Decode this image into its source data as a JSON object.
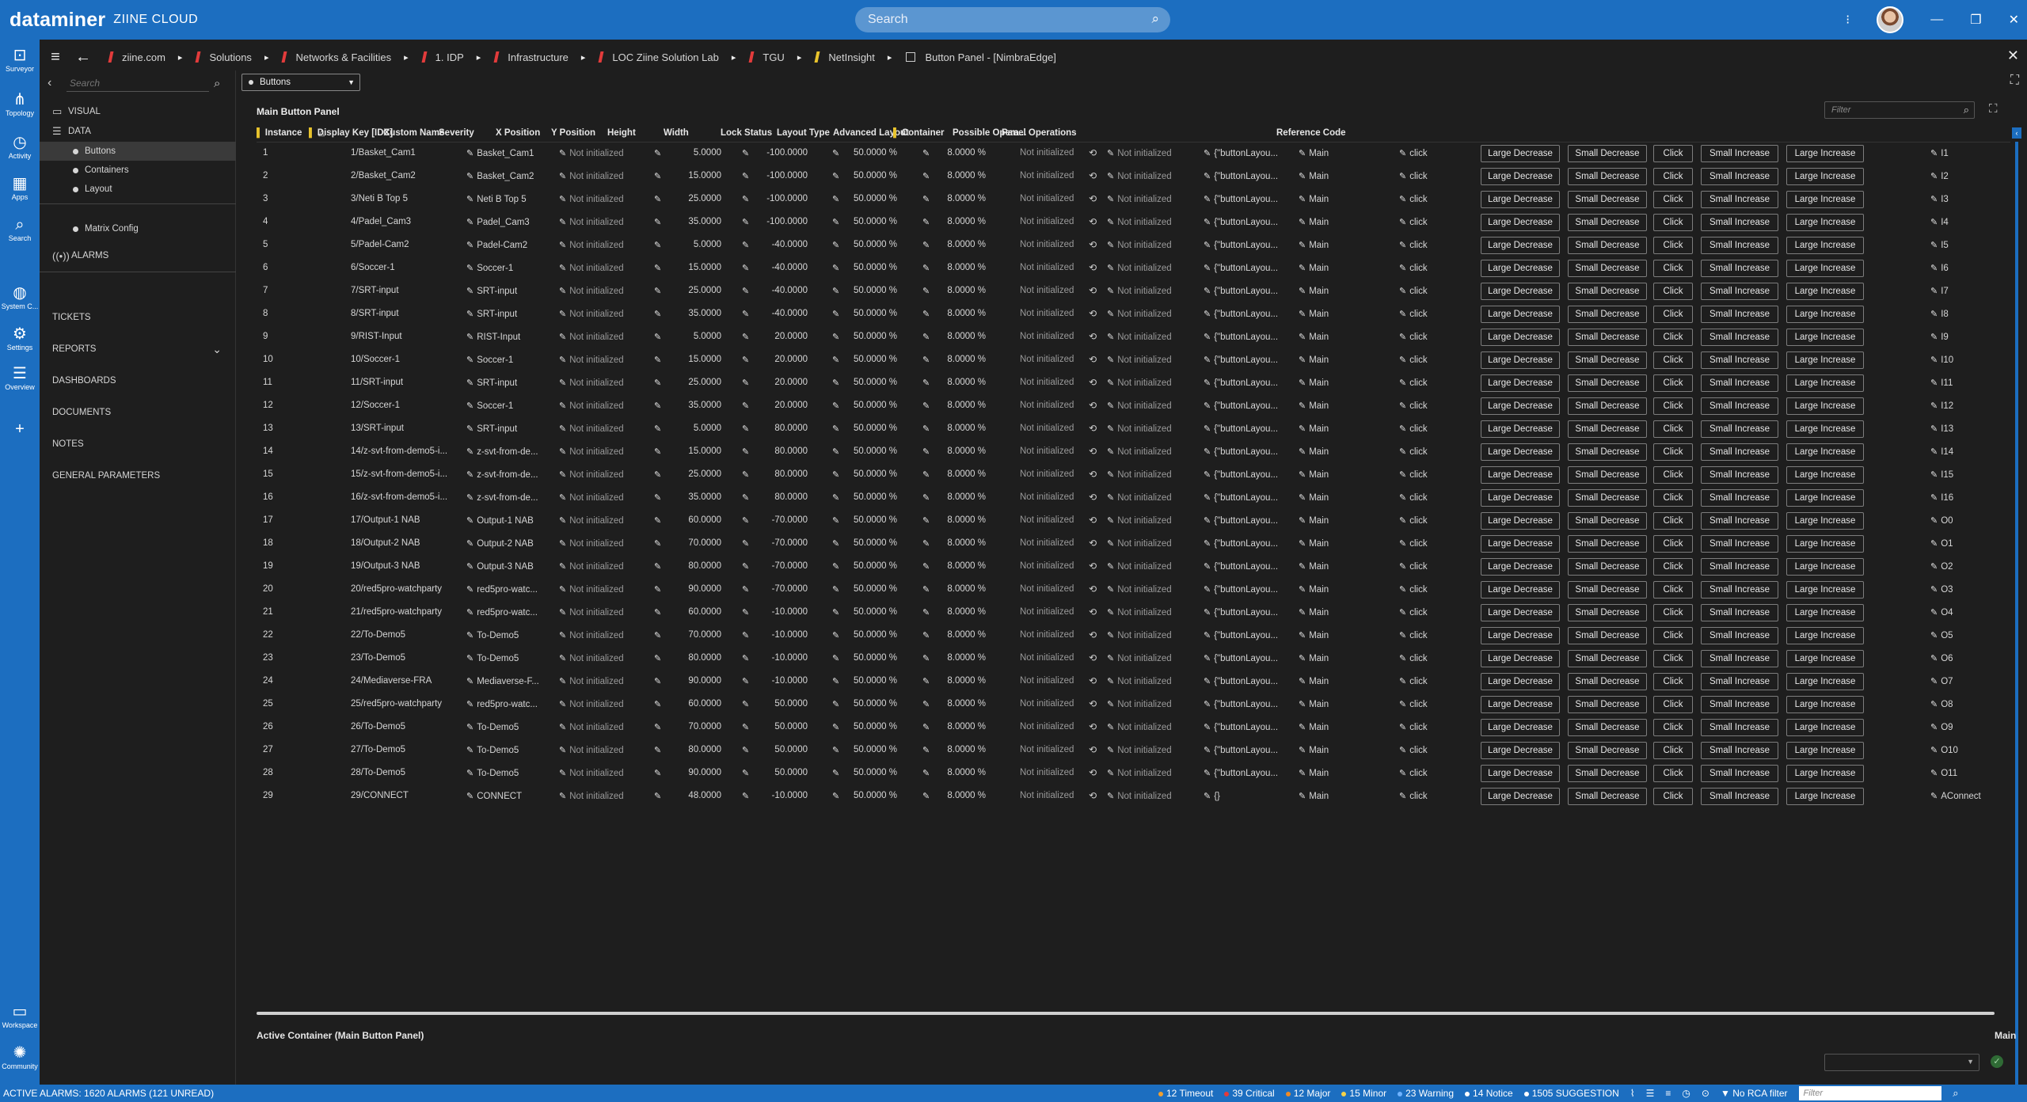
{
  "app": {
    "logo": "dataminer",
    "subtitle": "ZIINE CLOUD",
    "search_placeholder": "Search"
  },
  "rail": [
    {
      "label": "Surveyor",
      "icon": "surveyor-icon",
      "glyph": "⊡"
    },
    {
      "label": "Topology",
      "icon": "topology-icon",
      "glyph": "⋔"
    },
    {
      "label": "Activity",
      "icon": "activity-icon",
      "glyph": "◷"
    },
    {
      "label": "Apps",
      "icon": "apps-icon",
      "glyph": "▦"
    },
    {
      "label": "Search",
      "icon": "search-icon",
      "glyph": "⌕"
    },
    {
      "label": "System C...",
      "icon": "globe-icon",
      "glyph": "◍"
    },
    {
      "label": "Settings",
      "icon": "gear-icon",
      "glyph": "⚙"
    },
    {
      "label": "Overview",
      "icon": "overview-icon",
      "glyph": "☰"
    },
    {
      "label": "",
      "icon": "plus-icon",
      "glyph": "+"
    },
    {
      "label": "Workspace",
      "icon": "workspace-icon",
      "glyph": "▭"
    },
    {
      "label": "Community",
      "icon": "community-icon",
      "glyph": "✺"
    }
  ],
  "breadcrumbs": [
    {
      "label": "ziine.com",
      "flag": "red"
    },
    {
      "label": "Solutions",
      "flag": "red"
    },
    {
      "label": "Networks & Facilities",
      "flag": "red"
    },
    {
      "label": "1. IDP",
      "flag": "red"
    },
    {
      "label": "Infrastructure",
      "flag": "red"
    },
    {
      "label": "LOC Ziine Solution Lab",
      "flag": "red"
    },
    {
      "label": "TGU",
      "flag": "red"
    },
    {
      "label": "NetInsight",
      "flag": "yellow"
    },
    {
      "label": "Button Panel - [NimbraEdge]",
      "flag": "box"
    }
  ],
  "side": {
    "search_placeholder": "Search",
    "visual": "VISUAL",
    "data": "DATA",
    "children": [
      "Buttons",
      "Containers",
      "Layout"
    ],
    "matrix": "Matrix Config",
    "alarms": "ALARMS",
    "sections": [
      "TICKETS",
      "REPORTS",
      "DASHBOARDS",
      "DOCUMENTS",
      "NOTES",
      "GENERAL PARAMETERS"
    ]
  },
  "main": {
    "view_select": "Buttons",
    "panel_title": "Main Button Panel",
    "filter_placeholder": "Filter",
    "active_container": "Active Container (Main Button Panel)",
    "main_label": "Main"
  },
  "columns": [
    "Instance",
    "Display Key [IDX]",
    "Custom Name",
    "Severity",
    "X Position",
    "Y Position",
    "Height",
    "Width",
    "Lock Status",
    "Layout Type",
    "Advanced Layout",
    "Container",
    "Possible Opera...",
    "Panel Operations",
    "Reference Code"
  ],
  "common": {
    "severity": "Not initialized",
    "height": "50.0000 %",
    "width": "8.0000 %",
    "lock": "Not initialized",
    "layout_type": "Not initialized",
    "container": "Main",
    "possible_op": "click",
    "ops": [
      "Large Decrease",
      "Small Decrease",
      "Click",
      "Small Increase",
      "Large Increase"
    ]
  },
  "rows": [
    [
      "1",
      "1/Basket_Cam1",
      "Basket_Cam1",
      "5.0000",
      "-100.0000",
      "{\"buttonLayou...",
      "I1"
    ],
    [
      "2",
      "2/Basket_Cam2",
      "Basket_Cam2",
      "15.0000",
      "-100.0000",
      "{\"buttonLayou...",
      "I2"
    ],
    [
      "3",
      "3/Neti B Top 5",
      "Neti B Top 5",
      "25.0000",
      "-100.0000",
      "{\"buttonLayou...",
      "I3"
    ],
    [
      "4",
      "4/Padel_Cam3",
      "Padel_Cam3",
      "35.0000",
      "-100.0000",
      "{\"buttonLayou...",
      "I4"
    ],
    [
      "5",
      "5/Padel-Cam2",
      "Padel-Cam2",
      "5.0000",
      "-40.0000",
      "{\"buttonLayou...",
      "I5"
    ],
    [
      "6",
      "6/Soccer-1",
      "Soccer-1",
      "15.0000",
      "-40.0000",
      "{\"buttonLayou...",
      "I6"
    ],
    [
      "7",
      "7/SRT-input",
      "SRT-input",
      "25.0000",
      "-40.0000",
      "{\"buttonLayou...",
      "I7"
    ],
    [
      "8",
      "8/SRT-input",
      "SRT-input",
      "35.0000",
      "-40.0000",
      "{\"buttonLayou...",
      "I8"
    ],
    [
      "9",
      "9/RIST-Input",
      "RIST-Input",
      "5.0000",
      "20.0000",
      "{\"buttonLayou...",
      "I9"
    ],
    [
      "10",
      "10/Soccer-1",
      "Soccer-1",
      "15.0000",
      "20.0000",
      "{\"buttonLayou...",
      "I10"
    ],
    [
      "11",
      "11/SRT-input",
      "SRT-input",
      "25.0000",
      "20.0000",
      "{\"buttonLayou...",
      "I11"
    ],
    [
      "12",
      "12/Soccer-1",
      "Soccer-1",
      "35.0000",
      "20.0000",
      "{\"buttonLayou...",
      "I12"
    ],
    [
      "13",
      "13/SRT-input",
      "SRT-input",
      "5.0000",
      "80.0000",
      "{\"buttonLayou...",
      "I13"
    ],
    [
      "14",
      "14/z-svt-from-demo5-i...",
      "z-svt-from-de...",
      "15.0000",
      "80.0000",
      "{\"buttonLayou...",
      "I14"
    ],
    [
      "15",
      "15/z-svt-from-demo5-i...",
      "z-svt-from-de...",
      "25.0000",
      "80.0000",
      "{\"buttonLayou...",
      "I15"
    ],
    [
      "16",
      "16/z-svt-from-demo5-i...",
      "z-svt-from-de...",
      "35.0000",
      "80.0000",
      "{\"buttonLayou...",
      "I16"
    ],
    [
      "17",
      "17/Output-1 NAB",
      "Output-1 NAB",
      "60.0000",
      "-70.0000",
      "{\"buttonLayou...",
      "O0"
    ],
    [
      "18",
      "18/Output-2 NAB",
      "Output-2 NAB",
      "70.0000",
      "-70.0000",
      "{\"buttonLayou...",
      "O1"
    ],
    [
      "19",
      "19/Output-3 NAB",
      "Output-3 NAB",
      "80.0000",
      "-70.0000",
      "{\"buttonLayou...",
      "O2"
    ],
    [
      "20",
      "20/red5pro-watchparty",
      "red5pro-watc...",
      "90.0000",
      "-70.0000",
      "{\"buttonLayou...",
      "O3"
    ],
    [
      "21",
      "21/red5pro-watchparty",
      "red5pro-watc...",
      "60.0000",
      "-10.0000",
      "{\"buttonLayou...",
      "O4"
    ],
    [
      "22",
      "22/To-Demo5",
      "To-Demo5",
      "70.0000",
      "-10.0000",
      "{\"buttonLayou...",
      "O5"
    ],
    [
      "23",
      "23/To-Demo5",
      "To-Demo5",
      "80.0000",
      "-10.0000",
      "{\"buttonLayou...",
      "O6"
    ],
    [
      "24",
      "24/Mediaverse-FRA",
      "Mediaverse-F...",
      "90.0000",
      "-10.0000",
      "{\"buttonLayou...",
      "O7"
    ],
    [
      "25",
      "25/red5pro-watchparty",
      "red5pro-watc...",
      "60.0000",
      "50.0000",
      "{\"buttonLayou...",
      "O8"
    ],
    [
      "26",
      "26/To-Demo5",
      "To-Demo5",
      "70.0000",
      "50.0000",
      "{\"buttonLayou...",
      "O9"
    ],
    [
      "27",
      "27/To-Demo5",
      "To-Demo5",
      "80.0000",
      "50.0000",
      "{\"buttonLayou...",
      "O10"
    ],
    [
      "28",
      "28/To-Demo5",
      "To-Demo5",
      "90.0000",
      "50.0000",
      "{\"buttonLayou...",
      "O11"
    ],
    [
      "29",
      "29/CONNECT",
      "CONNECT",
      "48.0000",
      "-10.0000",
      "{}",
      "AConnect"
    ]
  ],
  "status": {
    "alarms": "ACTIVE ALARMS: 1620 ALARMS (121 UNREAD)",
    "counts": [
      {
        "label": "12 Timeout",
        "color": "#f0a030"
      },
      {
        "label": "39 Critical",
        "color": "#e23b3b"
      },
      {
        "label": "12 Major",
        "color": "#f08a24"
      },
      {
        "label": "15 Minor",
        "color": "#f3d24a"
      },
      {
        "label": "23 Warning",
        "color": "#6fb3ff"
      },
      {
        "label": "14 Notice",
        "color": "#ffffff"
      },
      {
        "label": "1505 SUGGESTION",
        "color": "#ffffff"
      }
    ],
    "rca": "No RCA filter",
    "filter_placeholder": "Filter"
  }
}
